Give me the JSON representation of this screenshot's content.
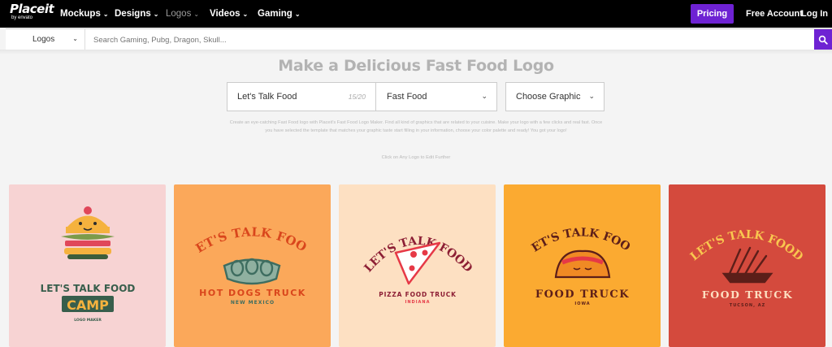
{
  "brand": {
    "name": "Placeit",
    "sub": "by envato"
  },
  "nav": [
    {
      "label": "Mockups",
      "active": true
    },
    {
      "label": "Designs",
      "active": true
    },
    {
      "label": "Logos",
      "active": false
    },
    {
      "label": "Videos",
      "active": true
    },
    {
      "label": "Gaming",
      "active": true
    }
  ],
  "nav_right": {
    "pricing": "Pricing",
    "account": "Free Account",
    "login": "Log In"
  },
  "search": {
    "category": "Logos",
    "placeholder": "Search Gaming, Pubg, Dragon, Skull..."
  },
  "main": {
    "headline": "Make a Delicious Fast Food Logo",
    "text_input": {
      "value": "Let's Talk Food",
      "counter": "15/20"
    },
    "category_select": {
      "value": "Fast Food"
    },
    "graphic_select": {
      "value": "Choose Graphic"
    },
    "description": "Create an eye-catching Fast Food logo with Placeit's Fast Food Logo Maker. Find all kind of graphics that are related to your cuisine. Make your logo with a few clicks and real fast. Once you have selected the template that matches your graphic taste start filling in your information, choose your color palette and ready! You got your logo!",
    "hint": "Click on Any Logo to Edit Further"
  },
  "cards": [
    {
      "bg": "#f7d3d3",
      "graphic": "burger-icon",
      "title": "LET'S TALK FOOD",
      "name": "CAMP",
      "sub": "LOGO MAKER"
    },
    {
      "bg": "#fba85a",
      "graphic": "hot-dogs-icon",
      "title": "LET'S TALK FOOD",
      "name": "HOT DOGS TRUCK",
      "sub": "NEW MEXICO"
    },
    {
      "bg": "#fde0c2",
      "graphic": "pizza-slice-icon",
      "title": "LET'S TALK FOOD",
      "name": "PIZZA FOOD TRUCK",
      "sub": "INDIANA"
    },
    {
      "bg": "#fbaa31",
      "graphic": "taco-icon",
      "title": "LET'S TALK FOOD",
      "name": "FOOD TRUCK",
      "sub": "IOWA"
    },
    {
      "bg": "#d44a3d",
      "graphic": "fries-icon",
      "title": "LET'S TALK FOOD",
      "name": "FOOD TRUCK",
      "sub": "TUCSON, AZ"
    }
  ],
  "colors": {
    "accent": "#6e22d3",
    "topbar": "#000000",
    "page": "#f4f4f4"
  }
}
